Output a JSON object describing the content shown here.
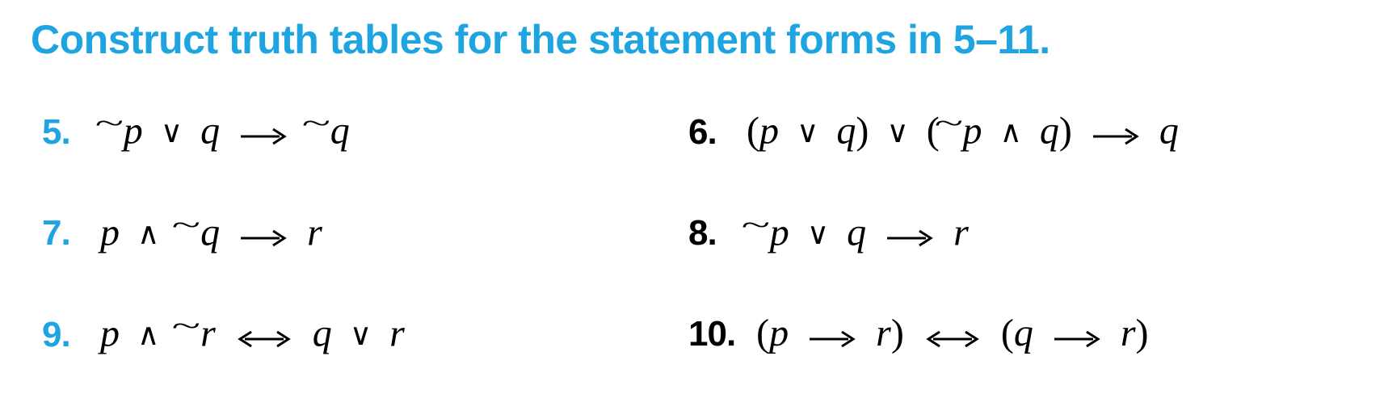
{
  "heading": "Construct truth tables for the statement forms in 5–11.",
  "items": {
    "q5": {
      "num": "5.",
      "expr_html": "<span class='neg'>~</span>p <span class='or'>∨</span> q <span class='imp'><svg width='60' height='24' viewBox='0 0 60 24'><line x1='2' y1='12' x2='50' y2='12' stroke='#000' stroke-width='3'/><polyline points='42,3 56,12 42,21' fill='none' stroke='#000' stroke-width='3'/></svg></span> <span class='neg'>~</span>q"
    },
    "q6": {
      "num": "6.",
      "expr_html": "<span class='paren'>(</span>p <span class='or'>∨</span> q<span class='paren'>)</span> <span class='or'>∨</span> <span class='paren'>(</span><span class='neg'>~</span>p <span class='and'>∧</span> q<span class='paren'>)</span> <span class='imp'><svg width='60' height='24' viewBox='0 0 60 24'><line x1='2' y1='12' x2='50' y2='12' stroke='#000' stroke-width='3'/><polyline points='42,3 56,12 42,21' fill='none' stroke='#000' stroke-width='3'/></svg></span> q"
    },
    "q7": {
      "num": "7.",
      "expr_html": "p <span class='and'>∧</span> <span class='neg'>~</span>q <span class='imp'><svg width='60' height='24' viewBox='0 0 60 24'><line x1='2' y1='12' x2='50' y2='12' stroke='#000' stroke-width='3'/><polyline points='42,3 56,12 42,21' fill='none' stroke='#000' stroke-width='3'/></svg></span> r"
    },
    "q8": {
      "num": "8.",
      "expr_html": "<span class='neg'>~</span>p <span class='or'>∨</span> q <span class='imp'><svg width='60' height='24' viewBox='0 0 60 24'><line x1='2' y1='12' x2='50' y2='12' stroke='#000' stroke-width='3'/><polyline points='42,3 56,12 42,21' fill='none' stroke='#000' stroke-width='3'/></svg></span> r"
    },
    "q9": {
      "num": "9.",
      "expr_html": "p <span class='and'>∧</span> <span class='neg'>~</span>r <span class='bic'><svg width='72' height='24' viewBox='0 0 72 24'><line x1='12' y1='12' x2='60' y2='12' stroke='#000' stroke-width='3'/><polyline points='20,3 6,12 20,21' fill='none' stroke='#000' stroke-width='3'/><polyline points='52,3 66,12 52,21' fill='none' stroke='#000' stroke-width='3'/></svg></span> q <span class='or'>∨</span> r"
    },
    "q10": {
      "num": "10.",
      "expr_html": "<span class='paren'>(</span>p <span class='imp'><svg width='60' height='24' viewBox='0 0 60 24'><line x1='2' y1='12' x2='50' y2='12' stroke='#000' stroke-width='3'/><polyline points='42,3 56,12 42,21' fill='none' stroke='#000' stroke-width='3'/></svg></span> r<span class='paren'>)</span> <span class='bic'><svg width='72' height='24' viewBox='0 0 72 24'><line x1='12' y1='12' x2='60' y2='12' stroke='#000' stroke-width='3'/><polyline points='20,3 6,12 20,21' fill='none' stroke='#000' stroke-width='3'/><polyline points='52,3 66,12 52,21' fill='none' stroke='#000' stroke-width='3'/></svg></span> <span class='paren'>(</span>q <span class='imp'><svg width='60' height='24' viewBox='0 0 60 24'><line x1='2' y1='12' x2='50' y2='12' stroke='#000' stroke-width='3'/><polyline points='42,3 56,12 42,21' fill='none' stroke='#000' stroke-width='3'/></svg></span> r<span class='paren'>)</span>"
    }
  }
}
